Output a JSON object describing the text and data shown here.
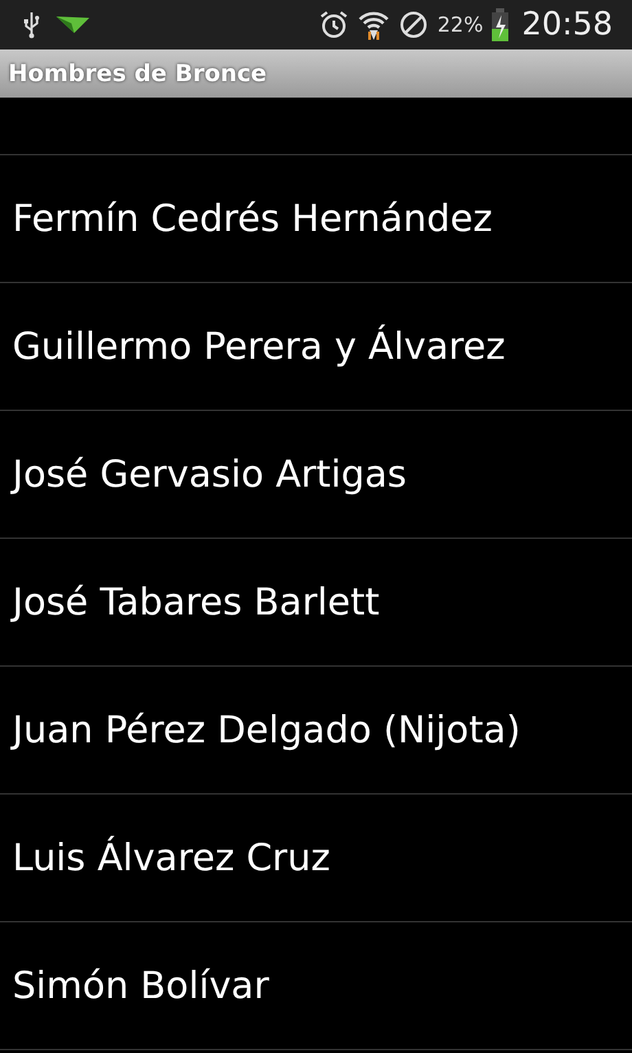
{
  "status_bar": {
    "battery_text": "22%",
    "time": "20:58"
  },
  "window": {
    "title": "Hombres de Bronce"
  },
  "list": {
    "items": [
      {
        "name": "Fermín Cedrés Hernández"
      },
      {
        "name": "Guillermo Perera y Álvarez"
      },
      {
        "name": "José Gervasio Artigas"
      },
      {
        "name": "José Tabares Barlett"
      },
      {
        "name": "Juan Pérez Delgado (Nijota)"
      },
      {
        "name": "Luis Álvarez Cruz"
      },
      {
        "name": "Simón Bolívar"
      }
    ]
  }
}
